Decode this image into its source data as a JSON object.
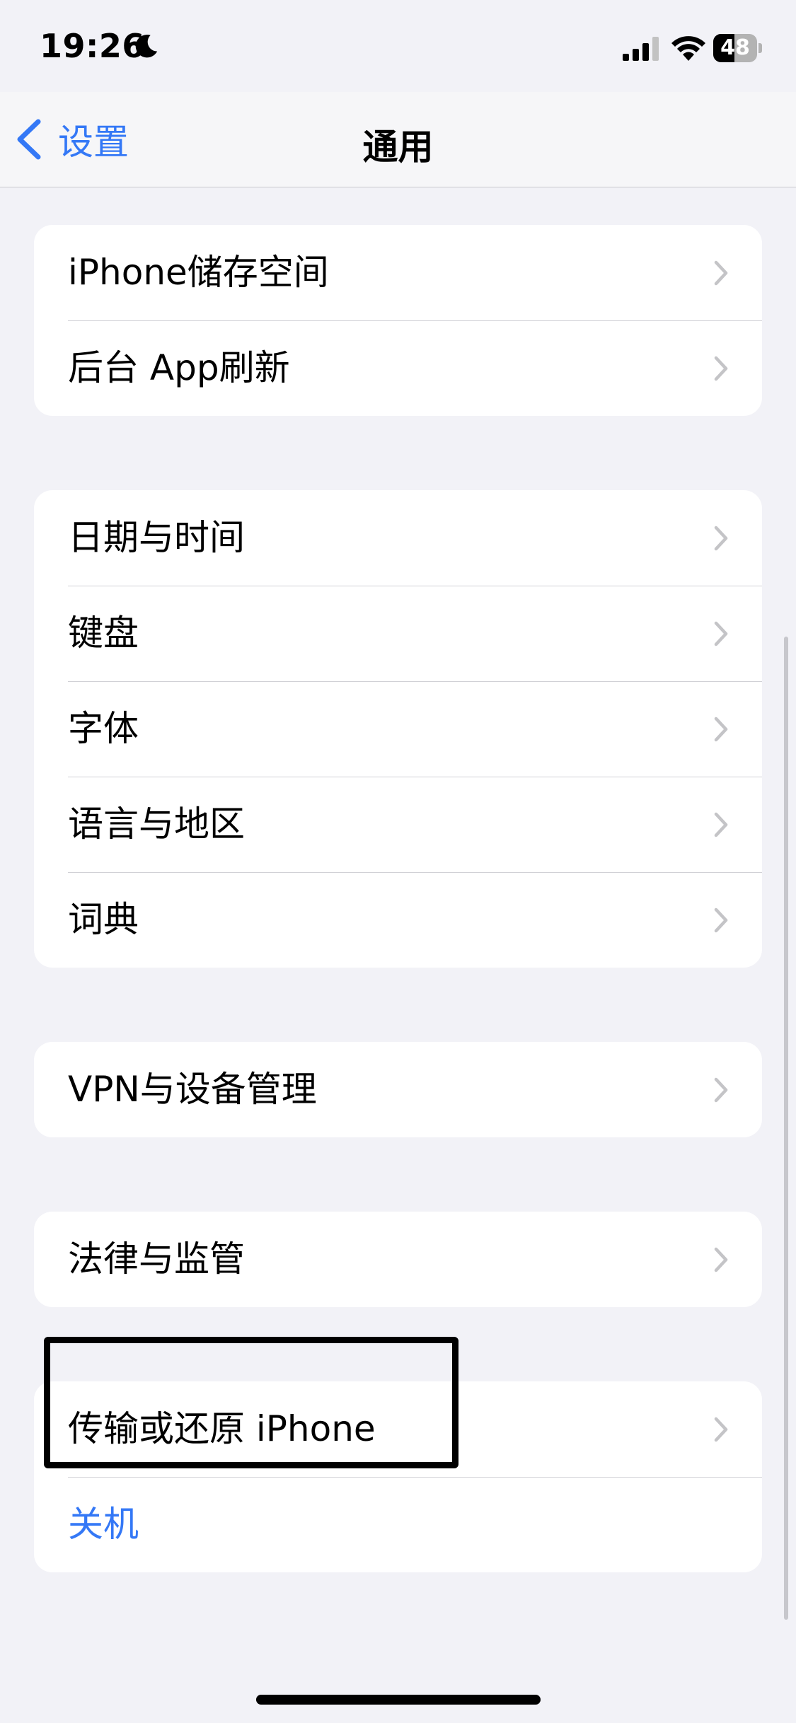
{
  "status_bar": {
    "time": "19:26",
    "battery_level": "48",
    "battery_fraction": 0.48
  },
  "nav": {
    "back_label": "设置",
    "title": "通用"
  },
  "groups": [
    {
      "rows": [
        {
          "label": "iPhone储存空间"
        },
        {
          "label": "后台 App刷新"
        }
      ]
    },
    {
      "rows": [
        {
          "label": "日期与时间"
        },
        {
          "label": "键盘"
        },
        {
          "label": "字体"
        },
        {
          "label": "语言与地区"
        },
        {
          "label": "词典"
        }
      ]
    },
    {
      "rows": [
        {
          "label": "VPN与设备管理"
        }
      ]
    },
    {
      "rows": [
        {
          "label": "法律与监管"
        }
      ]
    },
    {
      "rows": [
        {
          "label": "传输或还原 iPhone"
        },
        {
          "label": "关机"
        }
      ]
    }
  ],
  "colors": {
    "accent": "#3478f6",
    "background": "#f2f2f7"
  },
  "icons": {
    "back": "chevron-left-icon",
    "row": "chevron-right-icon",
    "focus": "moon-icon",
    "signal": "cellular-signal-icon",
    "wifi": "wifi-icon"
  }
}
